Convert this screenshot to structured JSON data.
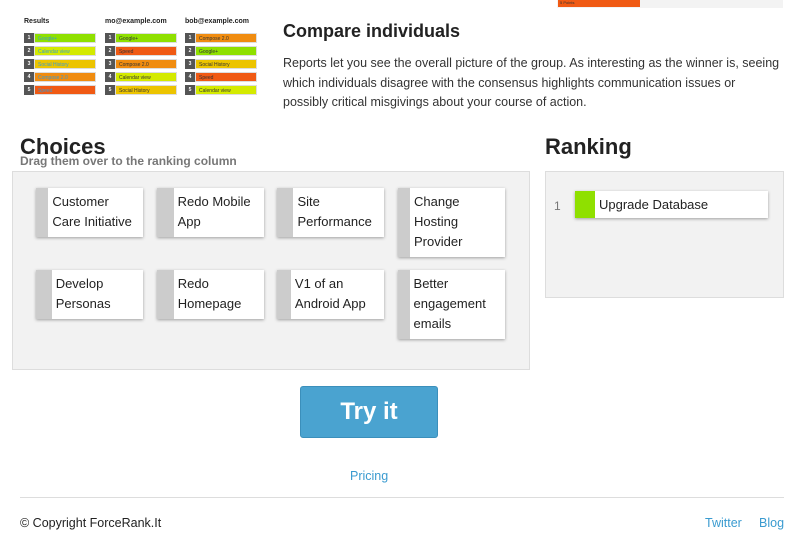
{
  "thumbnail": {
    "columns": [
      {
        "title": "Results",
        "items": [
          {
            "n": "1",
            "label": "Google+",
            "color": "#8fe000"
          },
          {
            "n": "2",
            "label": "Calendar view",
            "color": "#d4ea00"
          },
          {
            "n": "3",
            "label": "Social History",
            "color": "#ecc400"
          },
          {
            "n": "4",
            "label": "Compose 2.0",
            "color": "#f08c10"
          },
          {
            "n": "5",
            "label": "Speed",
            "color": "#f05a14"
          }
        ]
      },
      {
        "title": "mo@example.com",
        "items": [
          {
            "n": "1",
            "label": "Google+",
            "color": "#8fe000"
          },
          {
            "n": "2",
            "label": "Speed",
            "color": "#f05a14"
          },
          {
            "n": "3",
            "label": "Compose 2.0",
            "color": "#f08c10"
          },
          {
            "n": "4",
            "label": "Calendar view",
            "color": "#d4ea00"
          },
          {
            "n": "5",
            "label": "Social History",
            "color": "#ecc400"
          }
        ]
      },
      {
        "title": "bob@example.com",
        "items": [
          {
            "n": "1",
            "label": "Compose 2.0",
            "color": "#f08c10"
          },
          {
            "n": "2",
            "label": "Google+",
            "color": "#8fe000"
          },
          {
            "n": "3",
            "label": "Social History",
            "color": "#ecc400"
          },
          {
            "n": "4",
            "label": "Speed",
            "color": "#f05a14"
          },
          {
            "n": "5",
            "label": "Calendar view",
            "color": "#d4ea00"
          }
        ]
      }
    ],
    "top_bar_label": "5 Points"
  },
  "compare": {
    "title": "Compare individuals",
    "text": "Reports let you see the overall picture of the group. As interesting as the winner is, seeing which individuals disagree with the consensus highlights communication issues or possibly critical misgivings about your course of action."
  },
  "choices": {
    "title": "Choices",
    "subtitle": "Drag them over to the ranking column",
    "items": [
      "Customer Care Initiative",
      "Redo Mobile App",
      "Site Performance",
      "Change Hosting Provider",
      "Develop Personas",
      "Redo Homepage",
      "V1 of an Android App",
      "Better engagement emails"
    ]
  },
  "ranking": {
    "title": "Ranking",
    "items": [
      {
        "rank": "1",
        "label": "Upgrade Database",
        "color": "#8fe000"
      }
    ]
  },
  "cta": {
    "label": "Try it"
  },
  "links": {
    "pricing": "Pricing"
  },
  "footer": {
    "copyright": "© Copyright ForceRank.It",
    "twitter": "Twitter",
    "blog": "Blog"
  }
}
